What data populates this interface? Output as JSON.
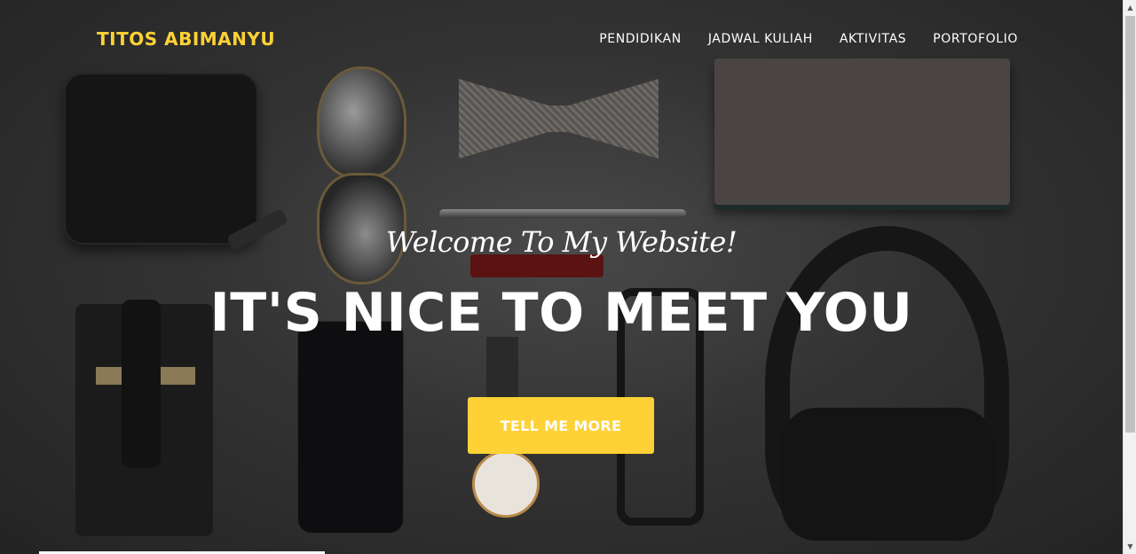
{
  "navbar": {
    "brand": "TITOS ABIMANYU",
    "links": [
      {
        "label": "PENDIDIKAN"
      },
      {
        "label": "JADWAL KULIAH"
      },
      {
        "label": "AKTIVITAS"
      },
      {
        "label": "PORTOFOLIO"
      }
    ]
  },
  "hero": {
    "lead_in": "Welcome To My Website!",
    "heading": "IT'S NICE TO MEET YOU",
    "button_label": "TELL ME MORE"
  },
  "scrollbar": {
    "up_icon": "▲",
    "down_icon": "▼"
  },
  "colors": {
    "accent": "#fed136",
    "text": "#ffffff",
    "background": "#3f3f3f"
  }
}
